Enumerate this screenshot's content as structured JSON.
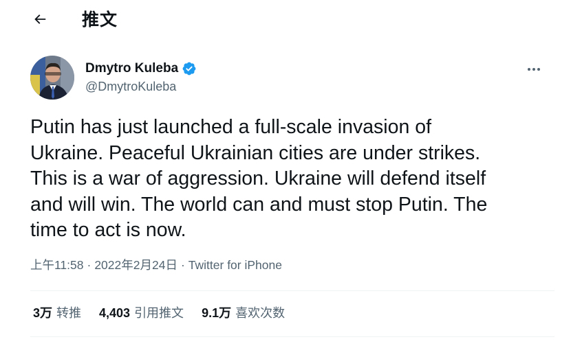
{
  "header": {
    "title": "推文",
    "back_icon": "arrow-left-icon"
  },
  "author": {
    "display_name": "Dmytro Kuleba",
    "handle": "@DmytroKuleba",
    "verified_icon": "verified-badge-icon",
    "more_icon": "more-horizontal-icon"
  },
  "tweet": {
    "text": "Putin has just launched a full-scale invasion of\nUkraine. Peaceful Ukrainian cities are under strikes.\nThis is a war of aggression. Ukraine will defend itself\nand will win. The world can and must stop Putin. The\ntime to act is now."
  },
  "meta": {
    "time": "上午11:58",
    "date": "2022年2月24日",
    "separator": "·",
    "source": "Twitter for iPhone"
  },
  "stats": {
    "retweets_count": "3万",
    "retweets_label": "转推",
    "quotes_count": "4,403",
    "quotes_label": "引用推文",
    "likes_count": "9.1万",
    "likes_label": "喜欢次数"
  },
  "colors": {
    "text_primary": "#0f1419",
    "text_secondary": "#536471",
    "verified_blue": "#1d9bf0",
    "divider": "#eff3f4"
  }
}
